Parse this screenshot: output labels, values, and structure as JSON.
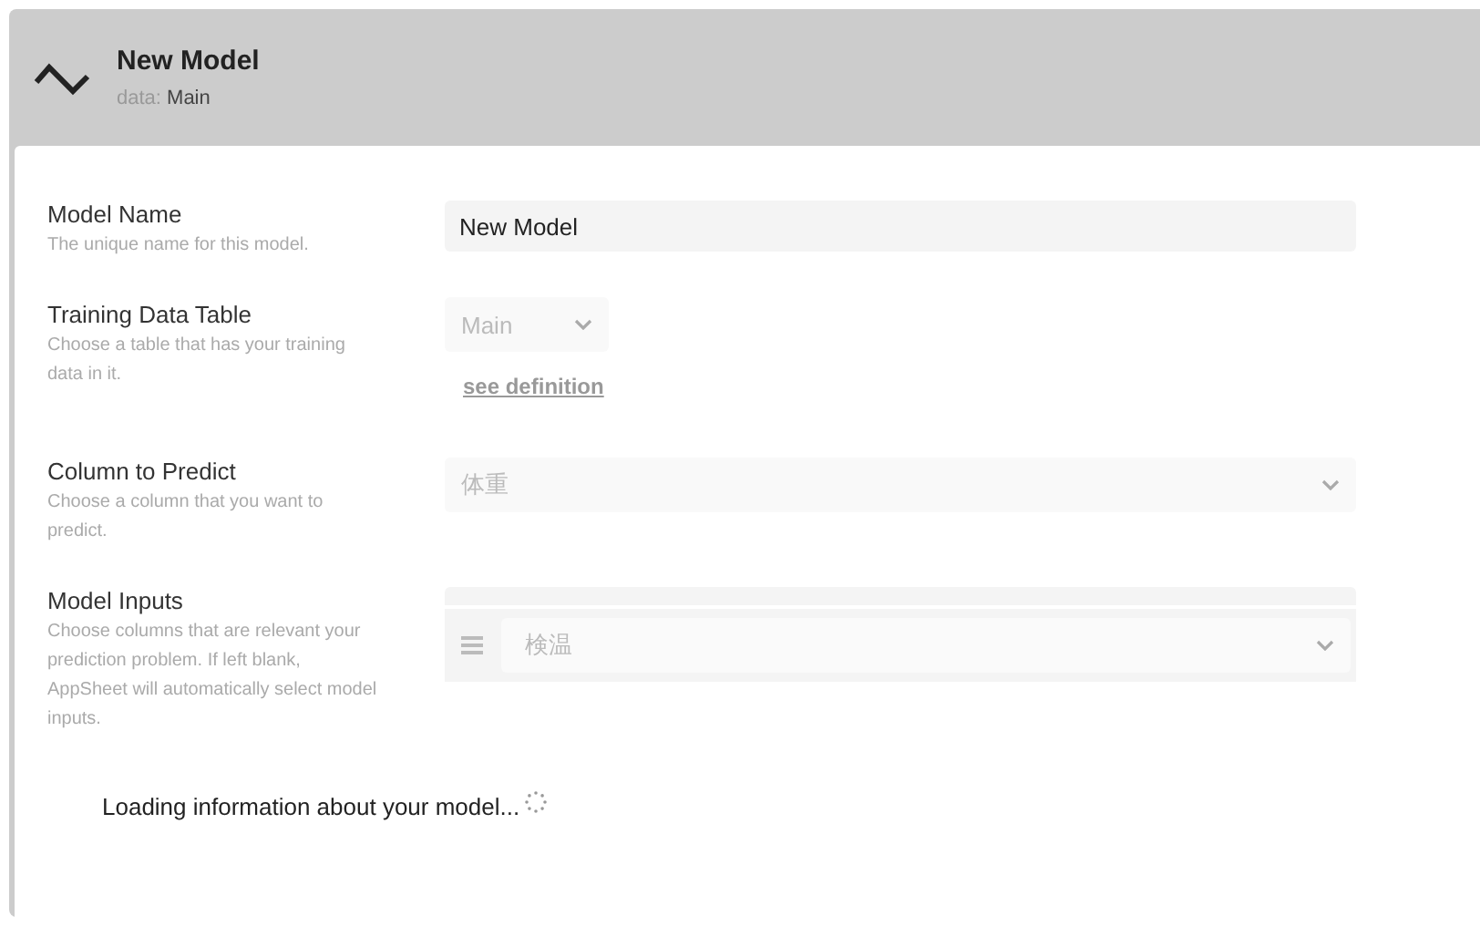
{
  "header": {
    "title": "New Model",
    "subtitle_label": "data:",
    "subtitle_value": "Main"
  },
  "fields": [
    {
      "kind": "text",
      "label": "Model Name",
      "hint": "The unique name for this model.",
      "value": "New Model"
    },
    {
      "kind": "short-select",
      "label": "Training Data Table",
      "hint": "Choose a table that has your training data in it.",
      "value": "Main",
      "disabled": true,
      "link": "see definition"
    },
    {
      "kind": "select",
      "label": "Column to Predict",
      "hint": "Choose a column that you want to predict.",
      "value": "体重",
      "disabled": true
    },
    {
      "kind": "list",
      "label": "Model Inputs",
      "hint": "Choose columns that are relevant your prediction problem. If left blank, AppSheet will automatically select model inputs.",
      "items": [
        {
          "value": "検温",
          "disabled": true
        }
      ]
    }
  ],
  "status": {
    "text": "Loading information about your model..."
  }
}
